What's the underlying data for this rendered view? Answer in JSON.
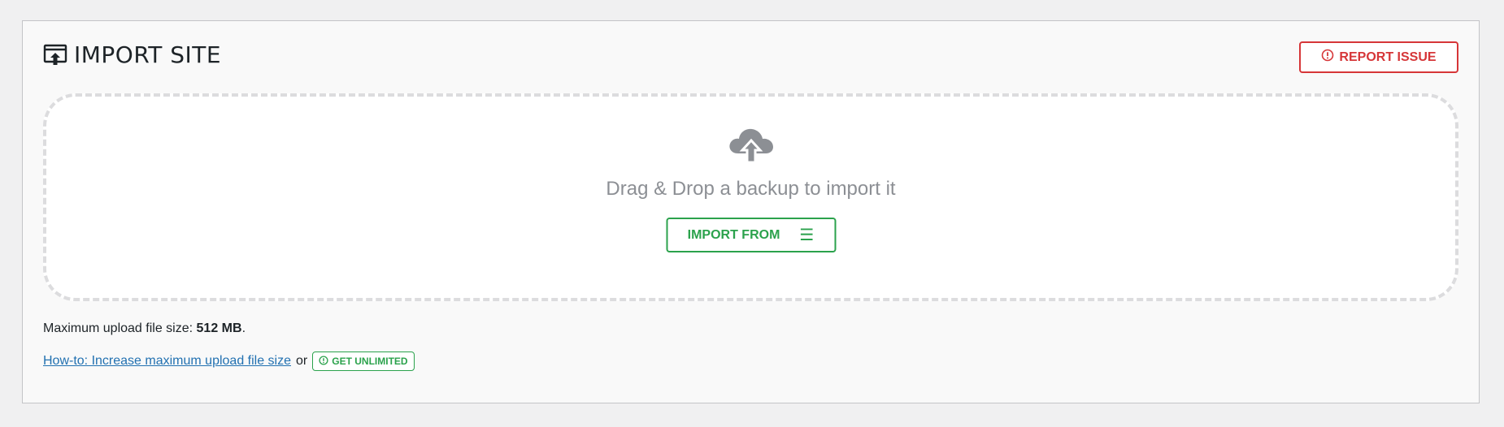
{
  "header": {
    "title": "IMPORT SITE",
    "icon": "import-site-icon"
  },
  "report_button": {
    "label": "REPORT ISSUE",
    "icon": "exclamation-circle-icon",
    "color": "#d63638"
  },
  "dropzone": {
    "icon": "cloud-upload-icon",
    "text": "Drag & Drop a backup to import it",
    "import_button": {
      "label": "IMPORT FROM",
      "icon": "hamburger-menu-icon",
      "glyph": "☰",
      "color": "#2ba24c"
    }
  },
  "upload_info": {
    "label": "Maximum upload file size:",
    "value": "512 MB",
    "suffix": "."
  },
  "howto": {
    "link_text": "How-to: Increase maximum upload file size",
    "separator": "or",
    "unlimited_label": "GET UNLIMITED",
    "unlimited_icon": "exclamation-circle-icon",
    "link_color": "#2271b1"
  }
}
